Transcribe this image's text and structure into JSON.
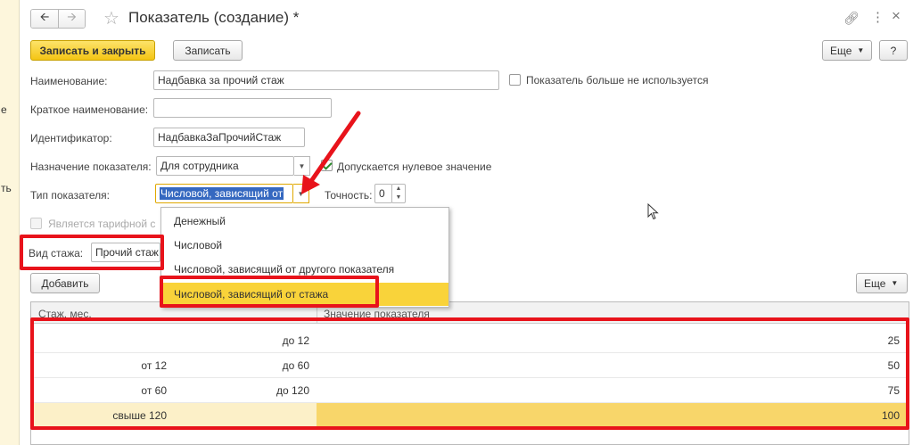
{
  "left_strip": {
    "items": [
      "е",
      "ть"
    ]
  },
  "window": {
    "title": "Показатель (создание) *",
    "nav": {
      "back_icon": "arrow-left-icon",
      "forward_icon": "arrow-right-icon"
    }
  },
  "toolbar": {
    "save_close_label": "Записать и закрыть",
    "save_label": "Записать",
    "more_label": "Еще",
    "help_label": "?"
  },
  "form": {
    "name_label": "Наименование:",
    "name_value": "Надбавка за прочий стаж",
    "not_used_label": "Показатель больше не используется",
    "short_name_label": "Краткое наименование:",
    "short_name_value": "",
    "id_label": "Идентификатор:",
    "id_value": "НадбавкаЗаПрочийСтаж",
    "purpose_label": "Назначение показателя:",
    "purpose_value": "Для сотрудника",
    "zero_allowed_label": "Допускается нулевое значение",
    "zero_allowed_checked": true,
    "type_label": "Тип показателя:",
    "type_value": "Числовой, зависящий от",
    "precision_label": "Точность:",
    "precision_value": "0",
    "tariff_label": "Является тарифной с",
    "seniority_label": "Вид стажа:",
    "seniority_value": "Прочий стаж"
  },
  "dropdown": {
    "options": [
      "Денежный",
      "Числовой",
      "Числовой, зависящий от другого показателя",
      "Числовой, зависящий от стажа"
    ],
    "selected_index": 3
  },
  "table_toolbar": {
    "add_label": "Добавить",
    "more_label": "Еще"
  },
  "table": {
    "columns": [
      "Стаж, мес.",
      "Значение показателя"
    ],
    "rows": [
      {
        "from": "",
        "to": "до 12",
        "value": "25"
      },
      {
        "from": "от 12",
        "to": "до 60",
        "value": "50"
      },
      {
        "from": "от 60",
        "to": "до 120",
        "value": "75"
      },
      {
        "from": "свыше 120",
        "to": "",
        "value": "100"
      }
    ],
    "selected_row": 3
  },
  "colors": {
    "annotation_red": "#e8131b",
    "primary_button": "#f4c514",
    "selection_yellow": "#f9d33a"
  }
}
